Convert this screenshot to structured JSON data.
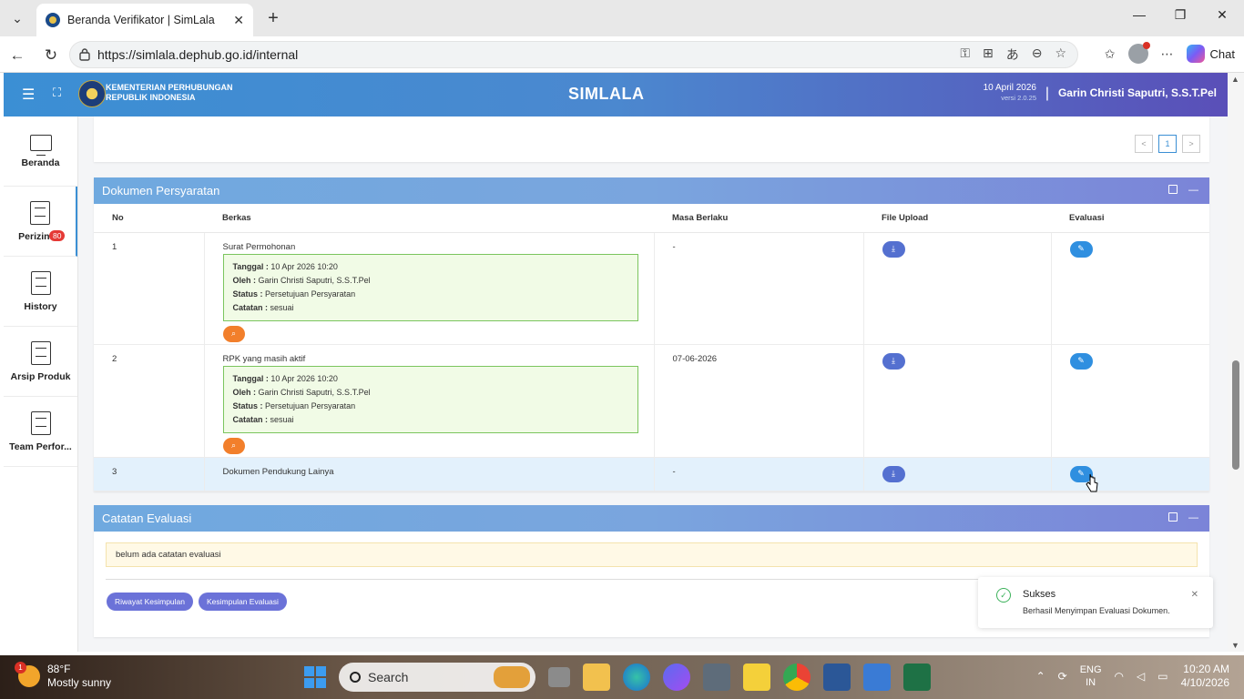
{
  "browser": {
    "tab_title": "Beranda Verifikator | SimLala",
    "url": "https://simlala.dephub.go.id/internal",
    "chat_label": "Chat"
  },
  "header": {
    "ministry_line1": "KEMENTERIAN PERHUBUNGAN",
    "ministry_line2": "REPUBLIK INDONESIA",
    "brand": "SIMLALA",
    "date": "10 April 2026",
    "version": "versi 2.0.25",
    "separator": "|",
    "user": "Garin Christi Saputri, S.S.T.Pel"
  },
  "sidebar": {
    "items": [
      {
        "label": "Beranda"
      },
      {
        "label": "Perizinan",
        "badge": "80"
      },
      {
        "label": "History"
      },
      {
        "label": "Arsip Produk"
      },
      {
        "label": "Team Perfor..."
      }
    ]
  },
  "pager": {
    "prev": "<",
    "current": "1",
    "next": ">"
  },
  "docs_panel": {
    "title": "Dokumen Persyaratan",
    "columns": [
      "No",
      "Berkas",
      "Masa Berlaku",
      "File Upload",
      "Evaluasi"
    ],
    "rows": [
      {
        "no": "1",
        "berkas": "Surat Permohonan",
        "masa": "-",
        "note": {
          "tanggal_label": "Tanggal :",
          "tanggal": "10 Apr 2026 10:20",
          "oleh_label": "Oleh :",
          "oleh": "Garin Christi Saputri, S.S.T.Pel",
          "status_label": "Status :",
          "status": "Persetujuan Persyaratan",
          "catatan_label": "Catatan :",
          "catatan": "sesuai"
        }
      },
      {
        "no": "2",
        "berkas": "RPK yang masih aktif",
        "masa": "07-06-2026",
        "note": {
          "tanggal_label": "Tanggal :",
          "tanggal": "10 Apr 2026 10:20",
          "oleh_label": "Oleh :",
          "oleh": "Garin Christi Saputri, S.S.T.Pel",
          "status_label": "Status :",
          "status": "Persetujuan Persyaratan",
          "catatan_label": "Catatan :",
          "catatan": "sesuai"
        }
      },
      {
        "no": "3",
        "berkas": "Dokumen Pendukung Lainya",
        "masa": "-"
      }
    ]
  },
  "eval_panel": {
    "title": "Catatan Evaluasi",
    "message": "belum ada catatan evaluasi",
    "btn_riwayat": "Riwayat Kesimpulan",
    "btn_kesimpulan": "Kesimpulan Evaluasi"
  },
  "toast": {
    "title": "Sukses",
    "message": "Berhasil Menyimpan Evaluasi Dokumen."
  },
  "taskbar": {
    "weather_badge": "1",
    "temp": "88°F",
    "condition": "Mostly sunny",
    "search": "Search",
    "lang1": "ENG",
    "lang2": "IN",
    "time": "10:20 AM",
    "date": "4/10/2026"
  },
  "colors": {
    "header_start": "#3b8fd4",
    "header_end": "#5a4fb8",
    "success": "#3bb15a",
    "orange_btn": "#f27f2b"
  }
}
